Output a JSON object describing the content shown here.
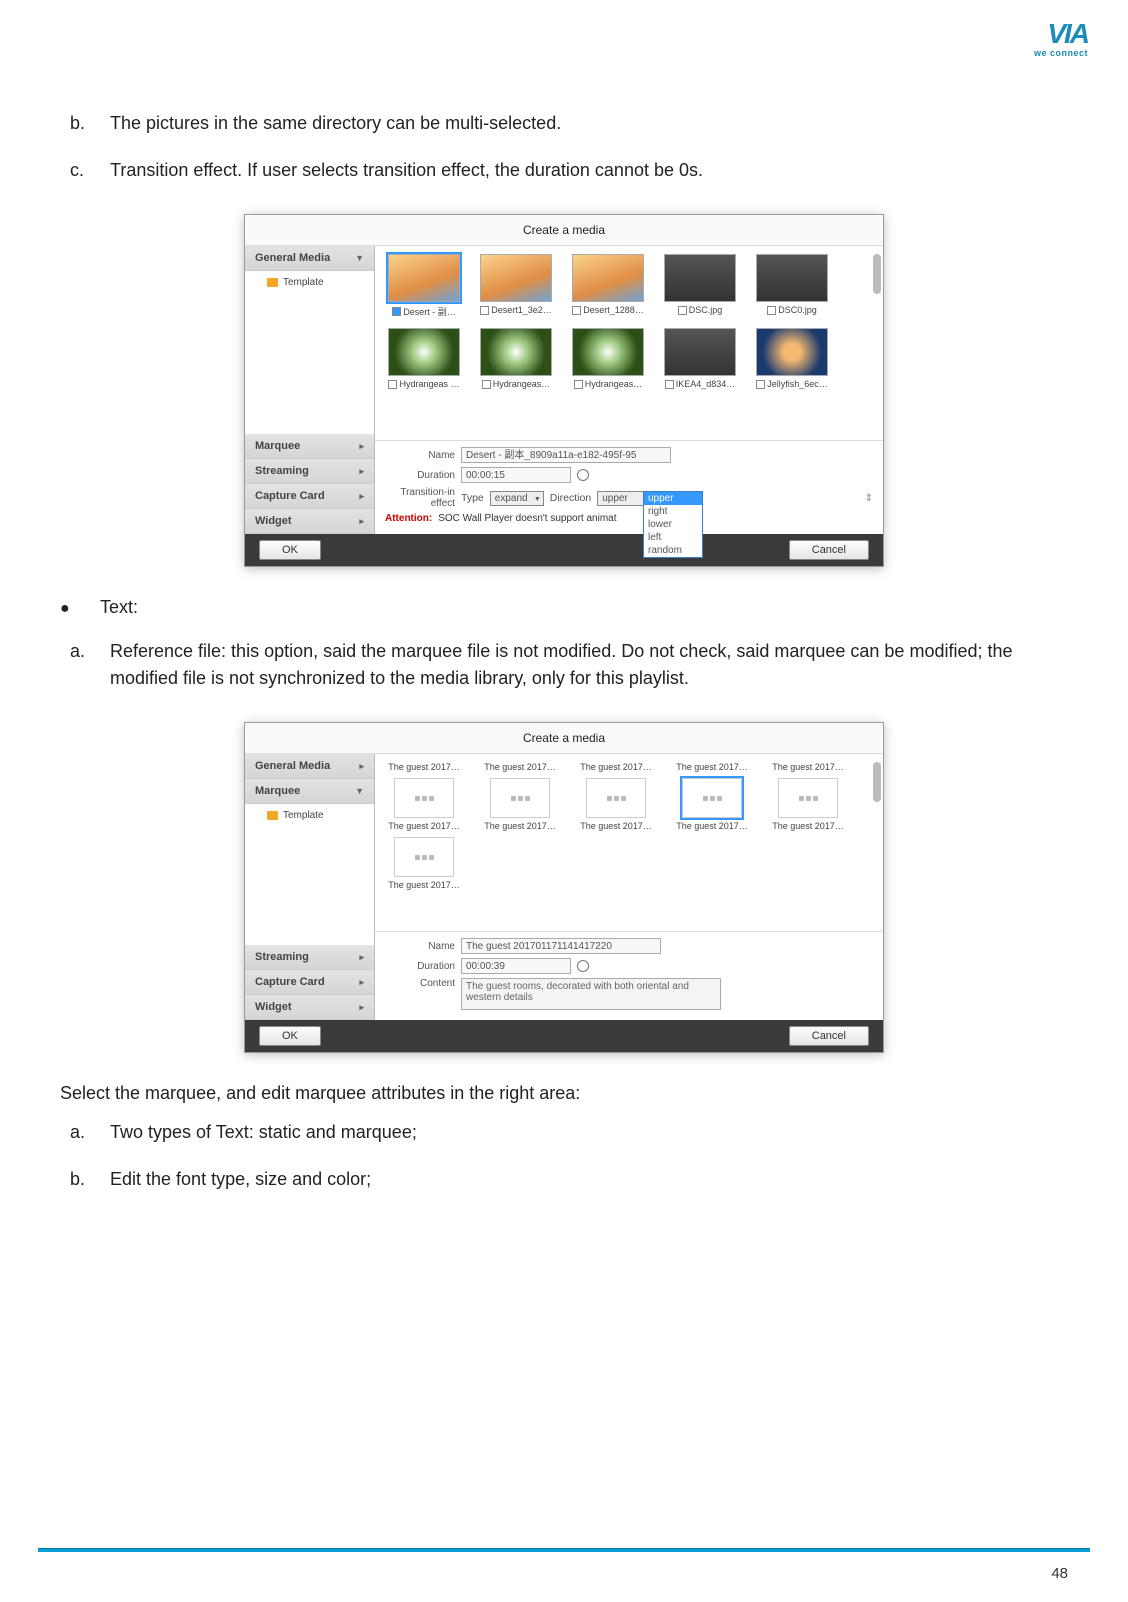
{
  "logo": {
    "mark": "VIA",
    "sub": "we connect"
  },
  "items_top": [
    {
      "marker": "b.",
      "text": "The pictures in the same directory can be multi-selected."
    },
    {
      "marker": "c.",
      "text": "Transition effect. If user selects transition effect, the duration cannot be 0s."
    }
  ],
  "bullet_text": "Text:",
  "item_a": {
    "marker": "a.",
    "text": "Reference file: this option, said the marquee file is not modified. Do not check, said marquee can be modified; the modified file is not synchronized to the media library, only for this playlist."
  },
  "select_intro": "Select the marquee, and edit marquee attributes in the right area:",
  "items_bottom": [
    {
      "marker": "a.",
      "text": "Two types of Text: static and marquee;"
    },
    {
      "marker": "b.",
      "text": "Edit the font type, size and color;"
    }
  ],
  "dialog1": {
    "title": "Create a media",
    "sidebar": {
      "general": "General Media",
      "template": "Template",
      "marquee": "Marquee",
      "streaming": "Streaming",
      "capture": "Capture Card",
      "widget": "Widget"
    },
    "thumbs": [
      {
        "label": "Desert - 副…",
        "cls": "desert",
        "checked": true
      },
      {
        "label": "Desert1_3e2…",
        "cls": "desert"
      },
      {
        "label": "Desert_1288…",
        "cls": "desert"
      },
      {
        "label": "DSC.jpg",
        "cls": "photo"
      },
      {
        "label": "DSC0.jpg",
        "cls": "photo"
      },
      {
        "label": "Hydrangeas …",
        "cls": "flower"
      },
      {
        "label": "Hydrangeas…",
        "cls": "flower"
      },
      {
        "label": "Hydrangeas…",
        "cls": "flower"
      },
      {
        "label": "IKEA4_d834…",
        "cls": "photo"
      },
      {
        "label": "Jellyfish_6ec…",
        "cls": "jelly"
      }
    ],
    "form": {
      "name_lab": "Name",
      "name_val": "Desert - 副本_8909a11a-e182-495f-95",
      "dur_lab": "Duration",
      "dur_val": "00:00:15",
      "trans_lab": "Transition-in effect",
      "type_lab": "Type",
      "type_val": "expand",
      "dir_lab": "Direction",
      "dir_val": "upper",
      "dir_opts": [
        "upper",
        "right",
        "lower",
        "left",
        "random"
      ],
      "attn_lab": "Attention:",
      "attn_txt": "SOC Wall Player doesn't support animat"
    },
    "ok": "OK",
    "cancel": "Cancel"
  },
  "dialog2": {
    "title": "Create a media",
    "sidebar": {
      "general": "General Media",
      "marquee": "Marquee",
      "template": "Template",
      "streaming": "Streaming",
      "capture": "Capture Card",
      "widget": "Widget"
    },
    "thumbs_row1": [
      "The guest 2017…",
      "The guest 2017…",
      "The guest 2017…",
      "The guest 2017…",
      "The guest 2017…"
    ],
    "thumbs_row2": [
      "The guest 2017…",
      "The guest 2017…",
      "The guest 2017…",
      "The guest 2017…",
      "The guest 2017…"
    ],
    "thumbs_row3": [
      "The guest 2017…"
    ],
    "selected_index": 3,
    "form": {
      "name_lab": "Name",
      "name_val": "The guest 201701171141417220",
      "dur_lab": "Duration",
      "dur_val": "00:00:39",
      "content_lab": "Content",
      "content_val": "The guest rooms, decorated with both oriental and western details"
    },
    "ok": "OK",
    "cancel": "Cancel"
  },
  "page_number": "48"
}
